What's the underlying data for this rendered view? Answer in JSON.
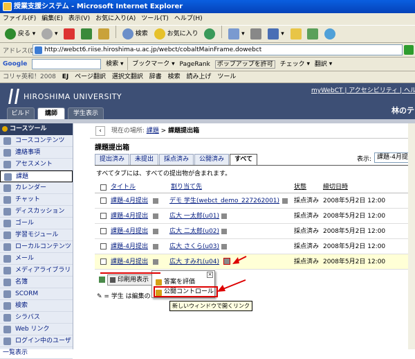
{
  "window": {
    "title": "授業支援システム - Microsoft Internet Explorer"
  },
  "menubar": [
    "ファイル(F)",
    "編集(E)",
    "表示(V)",
    "お気に入り(A)",
    "ツール(T)",
    "ヘルプ(H)"
  ],
  "toolbar": {
    "back": "戻る",
    "search": "検索",
    "favorites": "お気に入り"
  },
  "address": {
    "label": "アドレス(D)",
    "url": "http://webct6.riise.hiroshima-u.ac.jp/webct/cobaltMainFrame.dowebct"
  },
  "google": {
    "label": "Google",
    "search": "検索",
    "bookmark": "ブックマーク",
    "pagerank": "PageRank",
    "popup": "ポップアップを許可",
    "check": "チェック",
    "translate": "翻訳"
  },
  "extbar": [
    "コリャ英和！2008",
    "EJ",
    "ページ翻訳",
    "選択文翻訳",
    "辞書",
    "検索",
    "読み上げ",
    "ツール"
  ],
  "header": {
    "university": "HIROSHIMA UNIVERSITY",
    "links": "myWebCT | アクセシビリティ | ヘルプ",
    "course": "林のテ",
    "roles": [
      "ビルド",
      "講師",
      "学生表示"
    ],
    "active_role": 1
  },
  "sidebar": {
    "heading": "コースツール",
    "items": [
      "コースコンテンツ",
      "連絡事項",
      "アセスメント",
      "課題",
      "カレンダー",
      "チャット",
      "ディスカッション",
      "ゴール",
      "学習モジュール",
      "ローカルコンテンツ",
      "メール",
      "メディアライブラリ",
      "名簿",
      "SCORM",
      "検索",
      "シラバス",
      "Web リンク",
      "ログイン中のユーザ",
      "一覧表示"
    ],
    "selected": 3
  },
  "crumb": {
    "prefix": "現在の場所:",
    "parent": "課題",
    "current": "課題提出箱"
  },
  "main": {
    "title": "課題提出箱",
    "tabs": [
      "提出済み",
      "未提出",
      "採点済み",
      "公開済み",
      "すべて"
    ],
    "active_tab": 4,
    "filter_label": "表示:",
    "filter_value": "課題-4月提出",
    "description": "すべてタブには、すべての提出物が含まれます。",
    "columns": {
      "title": "タイトル",
      "assign": "割り当て先",
      "status": "状態",
      "due": "締切日時"
    },
    "rows": [
      {
        "title": "課題-4月提出",
        "assign": "デモ 学生(webct_demo_227262001)",
        "status": "採点済み",
        "due": "2008年5月2日 12:00"
      },
      {
        "title": "課題-4月提出",
        "assign": "広大 一太郎(u01)",
        "status": "採点済み",
        "due": "2008年5月2日 12:00"
      },
      {
        "title": "課題-4月提出",
        "assign": "広大 二太郎(u02)",
        "status": "採点済み",
        "due": "2008年5月2日 12:00"
      },
      {
        "title": "課題-4月提出",
        "assign": "広大 さくら(u03)",
        "status": "採点済み",
        "due": "2008年5月2日 12:00"
      },
      {
        "title": "課題-4月提出",
        "assign": "広大 すみれ(u04)",
        "status": "採点済み",
        "due": "2008年5月2日 12:00"
      }
    ],
    "print_label": "印刷用表示",
    "note": "= 学生 は編集の"
  },
  "popup": {
    "item1": "答案を評価",
    "item2": "公開コントロール",
    "close": "×"
  },
  "tooltip": "新しいウィンドウで開くリンク",
  "colors": {
    "header": "#3d4f75",
    "sidebar": "#e6ebf4",
    "annotation": "#dd0000"
  }
}
